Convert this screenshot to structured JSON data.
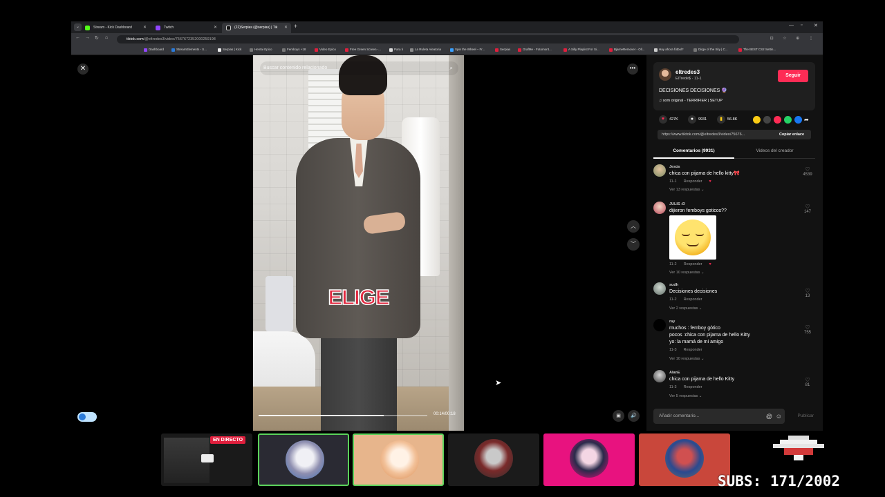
{
  "browser": {
    "tabs": [
      {
        "title": "Stream - Kick Dashboard"
      },
      {
        "title": "Twitch"
      },
      {
        "title": "(22)Serpias (@serpias) | Tik"
      }
    ],
    "url_host": "tiktok.com",
    "url_path": "/@eltredes3/video/7567672352000259198",
    "bookmarks": [
      "Dashboard",
      "StreamElements - S...",
      "Serpias | Kick",
      "Hentai Epico",
      "Femboys +18",
      "Video Epico",
      "Free Green Screen -...",
      "Para ti",
      "La Ruleta Aleatoria",
      "Spin the Wheel – Fr...",
      "Serpias",
      "GrafMe - Fotomont...",
      "A Silly Playlist For Si...",
      "BjarneRemover - Oll...",
      "Hay ahora fútbol?",
      "Dirge of the Sky | C...",
      "The BEST CS2 Settin..."
    ]
  },
  "video": {
    "search_placeholder": "Buscar contenido relacionado",
    "overlay_text": "ELIGE",
    "time": "00:14/00:18",
    "progress": 0.74
  },
  "author": {
    "username": "eltredes3",
    "subtitle": "ElTrede$ · 11-1",
    "follow_label": "Seguir",
    "description": "DECISIONES DECISIONES 🔮",
    "sound": "som original - TERRIFIER | SETUP"
  },
  "stats": {
    "likes": "427K",
    "comments": "9931",
    "saves": "56.8K"
  },
  "link": {
    "url": "https://www.tiktok.com/@eltredes3/video/75676...",
    "copy_label": "Copiar enlace"
  },
  "tabs": {
    "comments": "Comentarios (9931)",
    "creator_videos": "Videos del creador"
  },
  "ui": {
    "reply_label": "Responder"
  },
  "comments": [
    {
      "user": "Jesús",
      "text": "chica con pijama de hello kitty🎀",
      "date": "11-1",
      "replies": "Ver 13 respuestas ⌄",
      "likes": "4539"
    },
    {
      "user": "JULIS :D",
      "text": "dijieron femboys goticos??",
      "date": "11-2",
      "replies": "Ver 10 respuestas ⌄",
      "likes": "147"
    },
    {
      "user": "sudh",
      "text": "Decisiones decisiones",
      "date": "11-2",
      "replies": "Ver 2 respuestas ⌄",
      "likes": "13"
    },
    {
      "user": "ray",
      "lines": [
        "muchos : femboy gótico",
        "pocos :chica con pijama de hello Kitty",
        "yo: la mamá de mi amigo"
      ],
      "date": "11-3",
      "replies": "Ver 10 respuestas ⌄",
      "likes": "755"
    },
    {
      "user": "AlanE",
      "text": "chica con pijama de hello Kitty",
      "date": "11-3",
      "replies": "Ver 5 respuestas ⌄",
      "likes": "81"
    }
  ],
  "composer": {
    "placeholder": "Añadir comentario...",
    "publish_label": "Publicar"
  },
  "overlay": {
    "live_badge": "EN DIRECTO",
    "subs": "SUBS: 171/2002"
  }
}
